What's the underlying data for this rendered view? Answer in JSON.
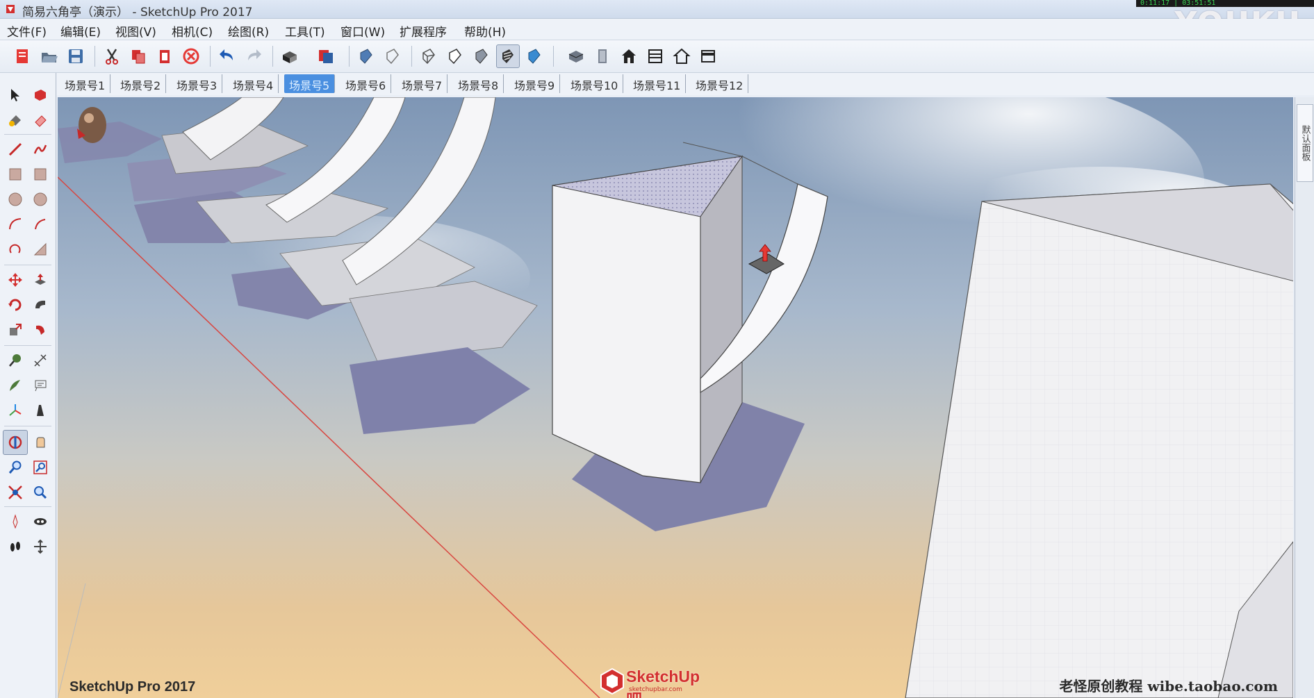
{
  "window": {
    "title": "简易六角亭（演示） - SketchUp Pro 2017",
    "overlay_watermark": "YOUKU",
    "status_text": "0:11:17 | 03:51:51"
  },
  "menu": {
    "items": [
      "文件(F)",
      "编辑(E)",
      "视图(V)",
      "相机(C)",
      "绘图(R)",
      "工具(T)",
      "窗口(W)",
      "扩展程序",
      "帮助(H)"
    ]
  },
  "toolbar": {
    "buttons": [
      "new-icon",
      "open-icon",
      "save-icon",
      "cut-icon",
      "copy-icon",
      "paste-icon",
      "erase-icon",
      "undo-icon",
      "redo-icon",
      "print-icon",
      "model-info-icon",
      "xray-icon",
      "back-edges-icon",
      "wireframe-icon",
      "hidden-line-icon",
      "shaded-icon",
      "shaded-textures-icon",
      "monochrome-icon",
      "iso-view-icon",
      "top-view-icon",
      "front-view-icon",
      "right-view-icon",
      "back-view-icon",
      "left-view-icon"
    ],
    "active_button": "shaded-textures-icon"
  },
  "scenes": {
    "tabs": [
      "场景号1",
      "场景号2",
      "场景号3",
      "场景号4",
      "场景号5",
      "场景号6",
      "场景号7",
      "场景号8",
      "场景号9",
      "场景号10",
      "场景号11",
      "场景号12"
    ],
    "active_index": 4
  },
  "left_tools": {
    "tools": [
      "select-icon",
      "make-component-icon",
      "paint-bucket-icon",
      "eraser-icon",
      "line-icon",
      "freehand-icon",
      "rectangle-icon",
      "rotated-rectangle-icon",
      "circle-icon",
      "polygon-icon",
      "arc-icon",
      "pie-icon",
      "two-point-arc-icon",
      "three-point-arc-icon",
      "move-icon",
      "push-pull-icon",
      "rotate-icon",
      "follow-me-icon",
      "scale-icon",
      "offset-icon",
      "tape-measure-icon",
      "dimension-icon",
      "protractor-icon",
      "text-icon",
      "axes-icon",
      "3d-text-icon",
      "orbit-icon",
      "pan-icon",
      "zoom-icon",
      "zoom-window-icon",
      "zoom-extents-icon",
      "previous-view-icon",
      "position-camera-icon",
      "look-around-icon",
      "walk-icon",
      "section-plane-icon"
    ],
    "active_tool": "orbit-icon"
  },
  "right_panel": {
    "tab_label": "默认面板"
  },
  "viewport": {
    "version_label": "SketchUp Pro 2017",
    "logo_text": "SketchUp吧",
    "logo_subtext": "sketchupbar.com",
    "credit_text": "老怪原创教程  wibe.taobao.com"
  }
}
